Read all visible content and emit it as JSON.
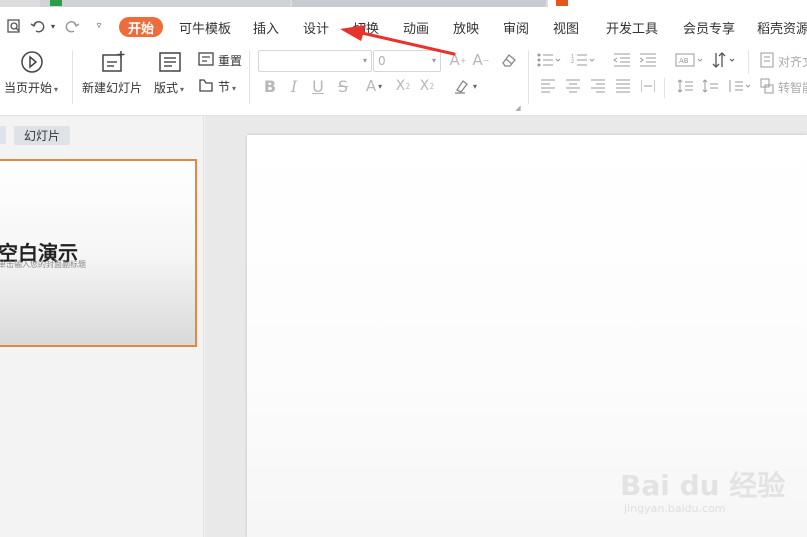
{
  "menu": {
    "active": "开始",
    "items": [
      "可牛模板",
      "插入",
      "设计",
      "切换",
      "动画",
      "放映",
      "审阅",
      "视图",
      "开发工具",
      "会员专享",
      "稻壳资源"
    ]
  },
  "ribbon": {
    "from_current": "当页开始",
    "new_slide": "新建幻灯片",
    "layout": "版式",
    "reset": "重置",
    "section": "节",
    "font_name_value": "",
    "font_size_value": "0",
    "align_text": "对齐文",
    "smart_convert": "转智能"
  },
  "left_panel": {
    "tab_slides": "幻灯片",
    "thumb_title": "空白演示",
    "thumb_subtitle": "单击输入您的封面副标题"
  },
  "watermark": {
    "brand": "Bai du 经验",
    "url": "jingyan.baidu.com"
  },
  "colors": {
    "accent": "#ec6d3b",
    "thumb_border": "#e28744",
    "arrow": "#e8322c"
  }
}
